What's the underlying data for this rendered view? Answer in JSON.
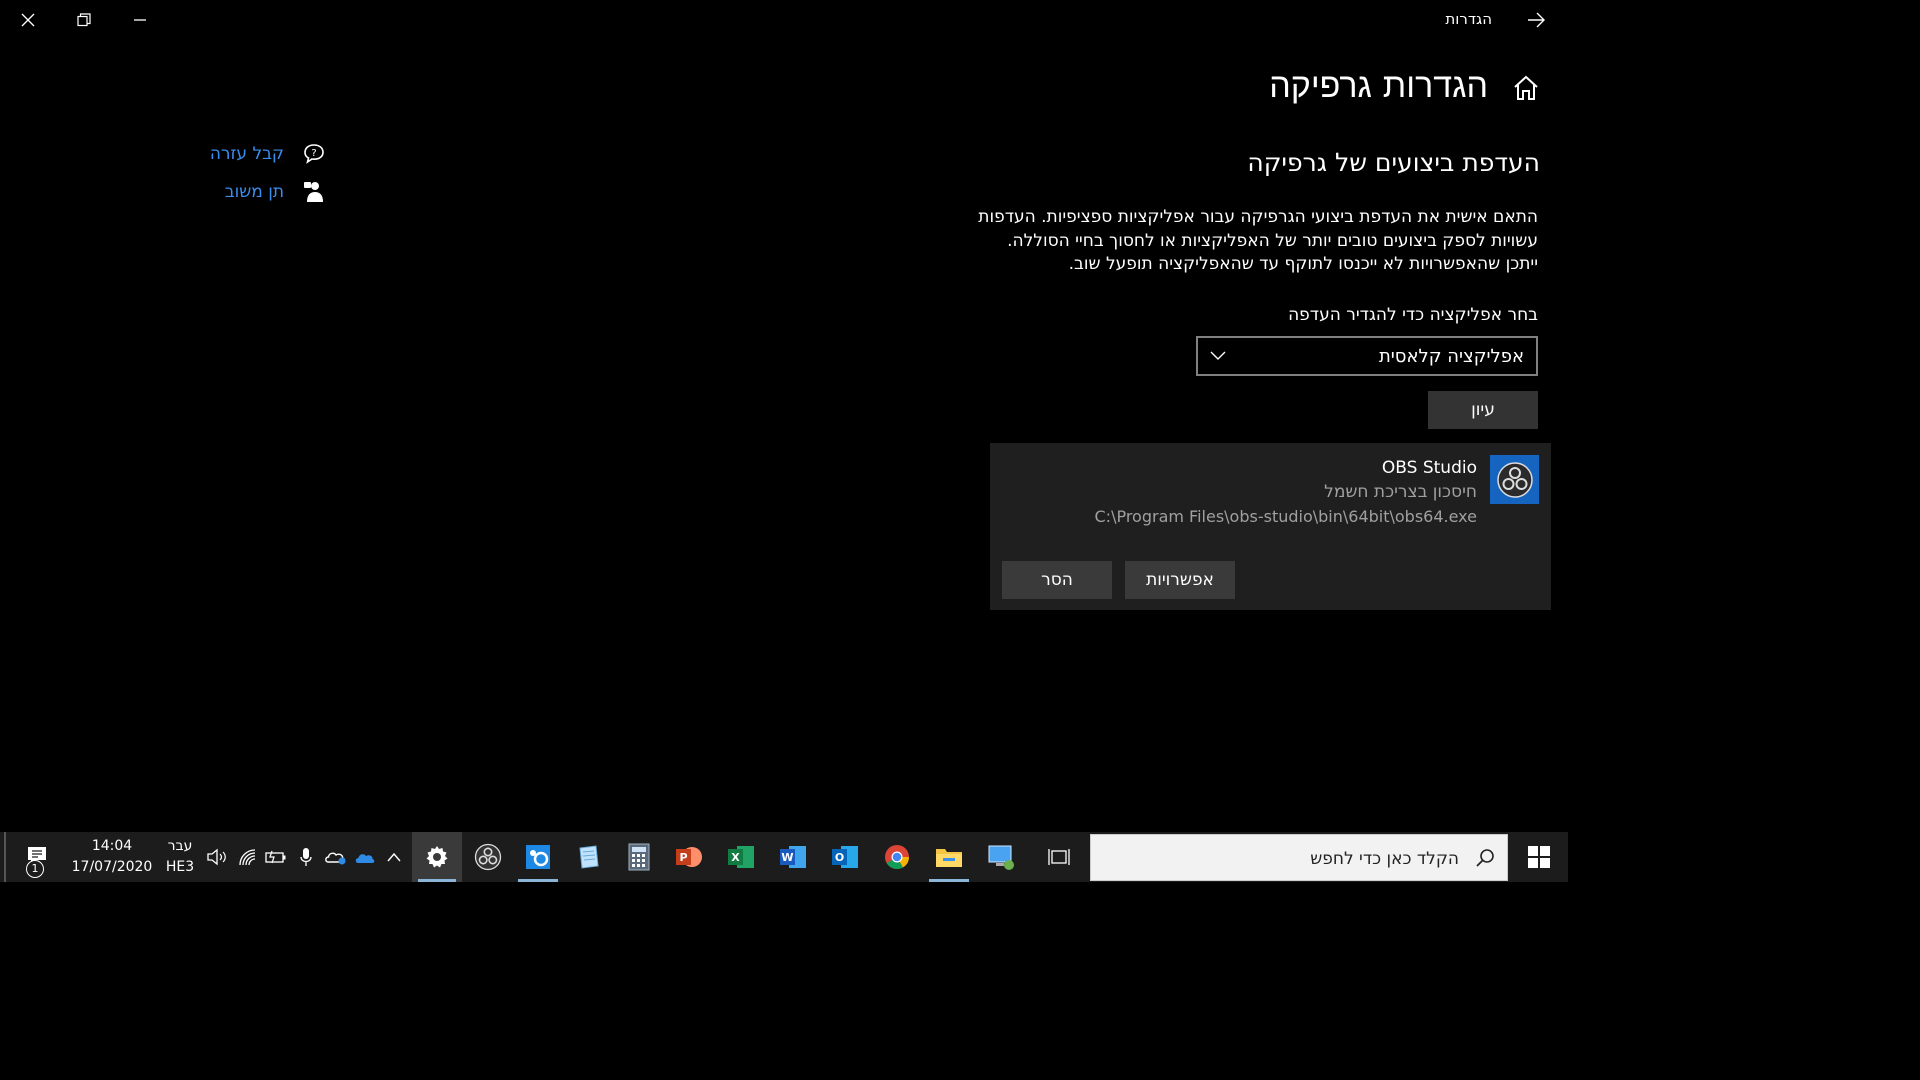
{
  "window": {
    "title": "הגדרות",
    "controls": [
      "minimize",
      "restore",
      "close"
    ]
  },
  "page": {
    "title": "הגדרות גרפיקה",
    "section_title": "העדפת ביצועים של גרפיקה",
    "description": "התאם אישית את העדפת ביצועי הגרפיקה עבור אפליקציות ספציפיות. העדפות עשויות לספק ביצועים טובים יותר של האפליקציות או לחסוך בחיי הסוללה. ייתכן שהאפשרויות לא ייכנסו לתוקף עד שהאפליקציה תופעל שוב.",
    "choose_label": "בחר אפליקציה כדי להגדיר העדפה",
    "app_type_select": "אפליקציה קלאסית",
    "browse_button": "עיון"
  },
  "app_entry": {
    "name": "OBS Studio",
    "preference": "חיסכון בצריכת חשמל",
    "path": "C:\\Program Files\\obs-studio\\bin\\64bit\\obs64.exe",
    "options_button": "אפשרויות",
    "remove_button": "הסר"
  },
  "help": {
    "get_help": "קבל עזרה",
    "give_feedback": "תן משוב"
  },
  "taskbar": {
    "search_placeholder": "הקלד כאן כדי לחפש",
    "apps": [
      "task-view",
      "remote-desktop",
      "file-explorer",
      "chrome",
      "outlook",
      "word",
      "excel",
      "powerpoint",
      "calculator",
      "notepad",
      "control-panel",
      "obs-studio",
      "settings"
    ],
    "language_line1": "עבר",
    "language_line2": "HE3",
    "time": "14:04",
    "date": "17/07/2020",
    "notification_count": "1"
  }
}
